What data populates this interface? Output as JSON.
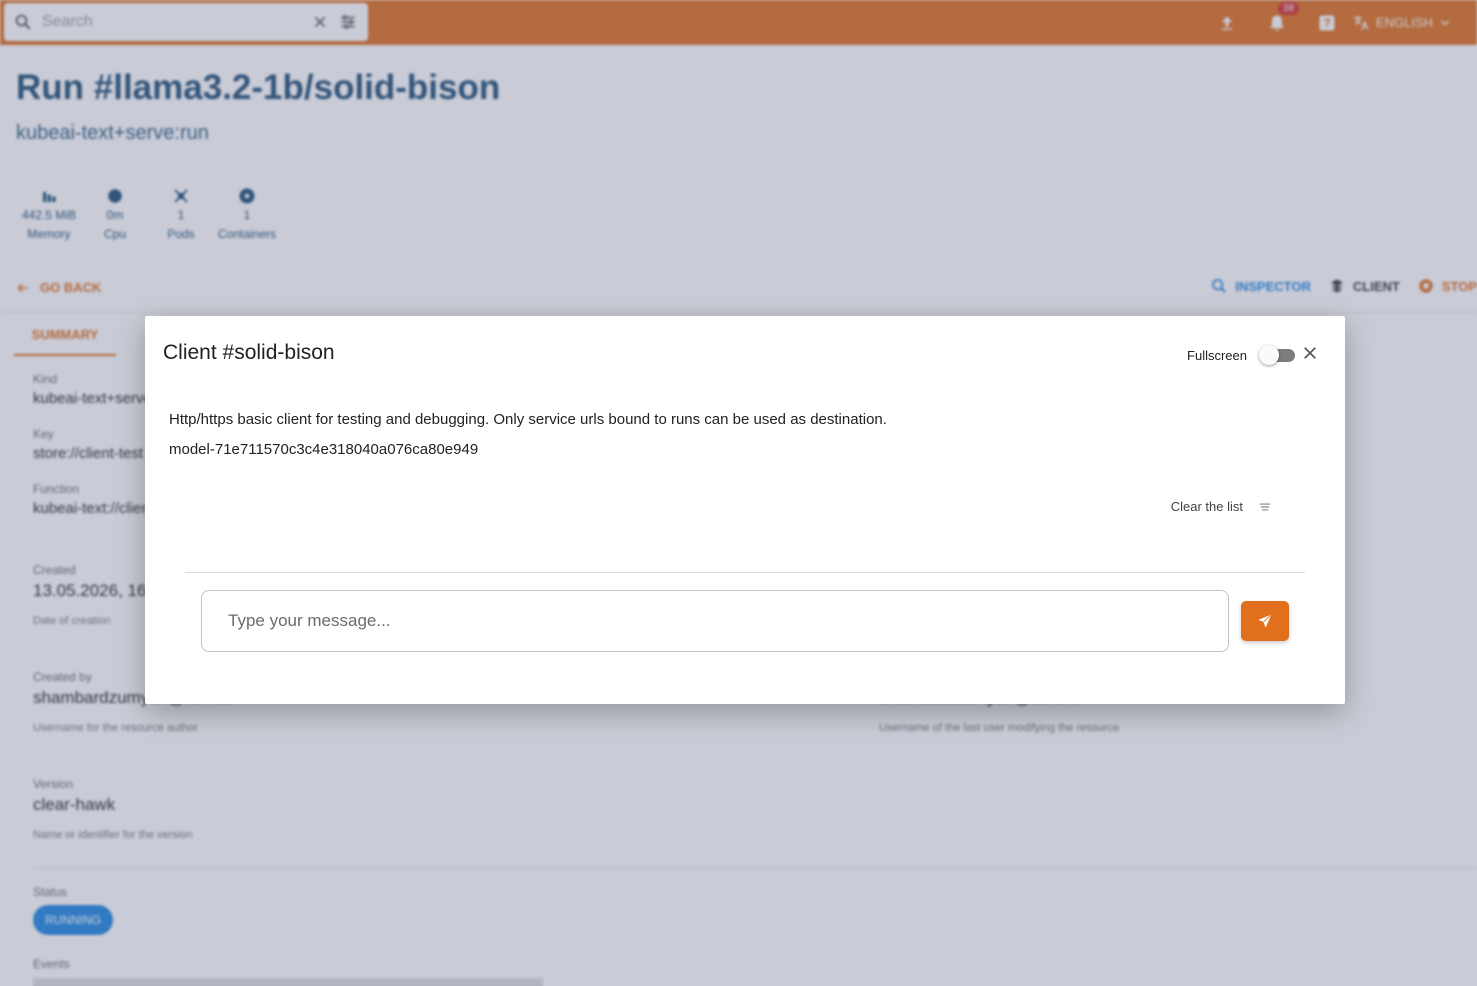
{
  "appbar": {
    "search_placeholder": "Search",
    "notifications_count": "38",
    "language": "ENGLISH"
  },
  "page": {
    "title": "Run #llama3.2-1b/solid-bison",
    "subtitle": "kubeai-text+serve:run"
  },
  "stats": [
    {
      "value": "442.5 MiB",
      "label": "Memory",
      "icon": "memory-icon"
    },
    {
      "value": "0m",
      "label": "Cpu",
      "icon": "cpu-icon"
    },
    {
      "value": "1",
      "label": "Pods",
      "icon": "pods-icon"
    },
    {
      "value": "1",
      "label": "Containers",
      "icon": "containers-icon"
    }
  ],
  "toolbar": {
    "go_back": "GO BACK",
    "inspector": "INSPECTOR",
    "client": "CLIENT",
    "stop": "STOP"
  },
  "tabs": {
    "summary": "SUMMARY"
  },
  "fields": {
    "kind_label": "Kind",
    "kind_value": "kubeai-text+serve",
    "key_label": "Key",
    "key_value": "store://client-test",
    "function_label": "Function",
    "function_value": "kubeai-text://client",
    "created_label": "Created",
    "created_value": "13.05.2026, 16",
    "created_help": "Date of creation",
    "created_by_label": "Created by",
    "created_by_value": "shambardzumyan@fbk.eu",
    "created_by_help": "Username for the resource author",
    "updated_by_value": "shambardzumyan@fbk.eu",
    "updated_by_help": "Username of the last user modifying the resource",
    "version_label": "Version",
    "version_value": "clear-hawk",
    "version_help": "Name or identifier for the version",
    "status_label": "Status",
    "status_value": "RUNNING",
    "events_label": "Events"
  },
  "modal": {
    "title": "Client #solid-bison",
    "fullscreen_label": "Fullscreen",
    "description": "Http/https basic client for testing and debugging. Only service urls bound to runs can be used as destination.",
    "model": "model-71e711570c3c4e318040a076ca80e949",
    "clear_label": "Clear the list",
    "input_placeholder": "Type your message..."
  },
  "colors": {
    "accent": "#e0701e",
    "primary_text": "#1f4f76",
    "running": "#1e88e5"
  }
}
